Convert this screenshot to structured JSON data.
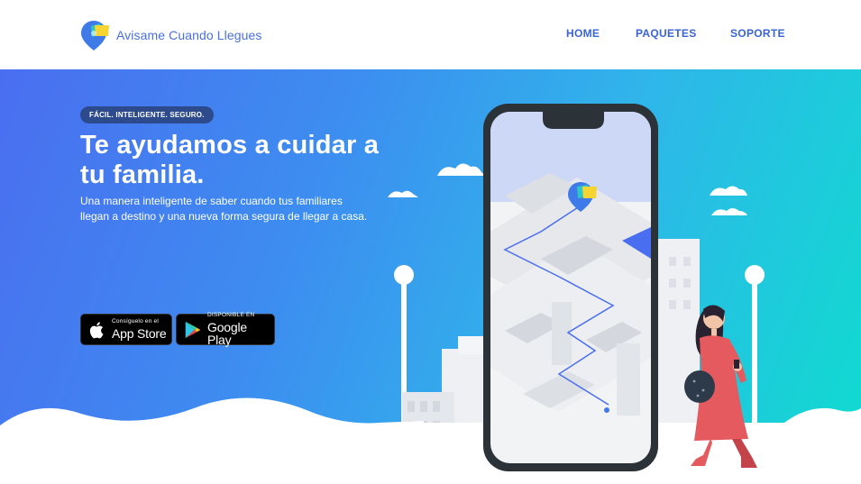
{
  "brand": {
    "name": "Avisame Cuando Llegues",
    "colors": {
      "primary": "#4a6fdc",
      "nav": "#3a63d8",
      "badge": "#2c4a8c",
      "pin_yellow": "#f6d432",
      "pin_blue": "#3e7be8"
    }
  },
  "nav": {
    "items": [
      {
        "label": "HOME"
      },
      {
        "label": "PAQUETES"
      },
      {
        "label": "SOPORTE"
      }
    ]
  },
  "hero": {
    "badge": "FÁCIL. INTELIGENTE. SEGURO.",
    "headline": "Te ayudamos a cuidar a tu familia.",
    "subtext": "Una manera inteligente de saber cuando tus familiares llegan a destino y una nueva forma segura de llegar a casa.",
    "gradient": [
      "#4a6ef0",
      "#3d8df0",
      "#2fb6ea",
      "#0fdccf"
    ]
  },
  "stores": {
    "appstore": {
      "small": "Consíguelo en el",
      "big": "App Store",
      "icon": "apple-icon"
    },
    "googleplay": {
      "small": "DISPONIBLE EN",
      "big": "Google Play",
      "icon": "google-play-icon"
    }
  },
  "illustration": {
    "icons": [
      "phone-illustration",
      "map-pin-icon",
      "woman-walking-illustration",
      "cloud-icon",
      "street-lamp-icon",
      "building-icon"
    ]
  }
}
